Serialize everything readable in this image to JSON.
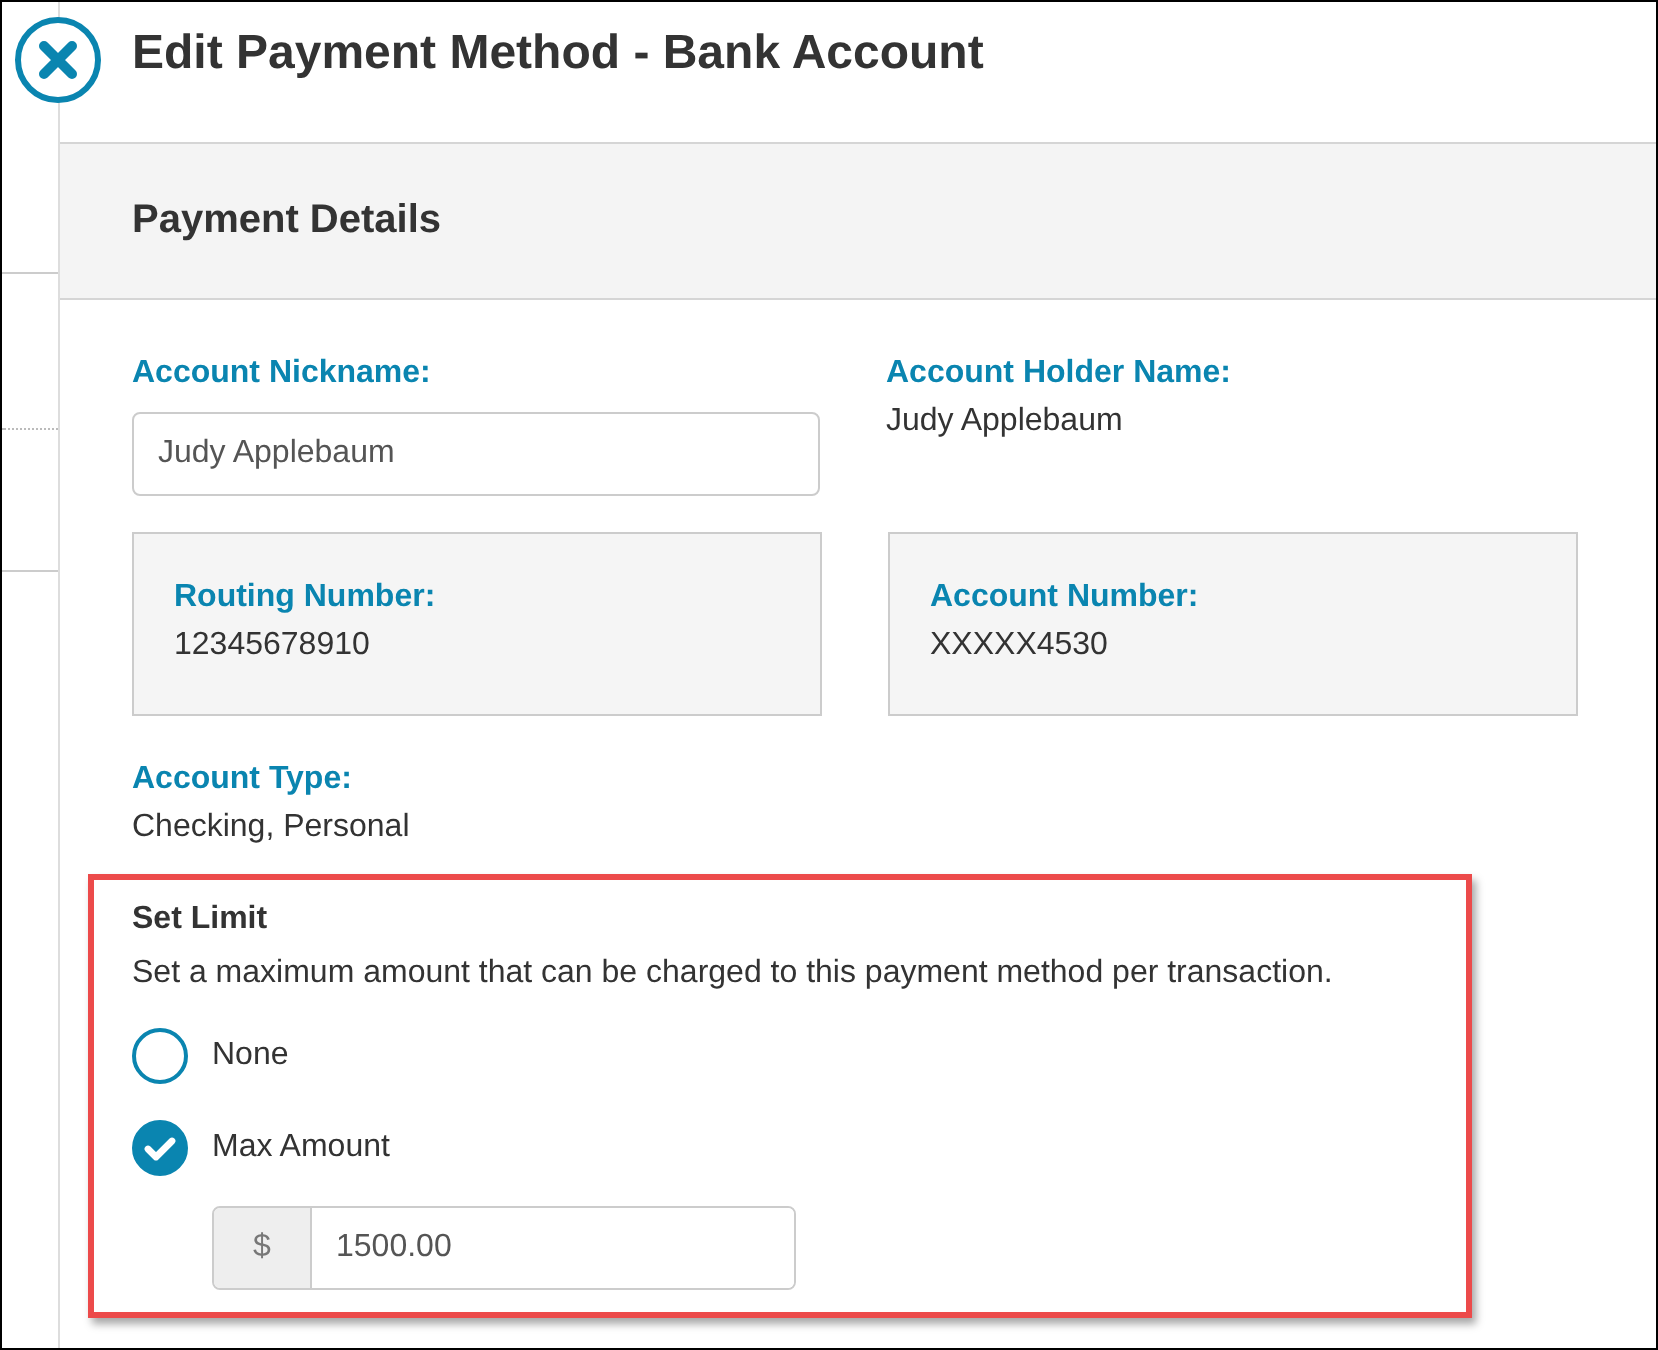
{
  "window": {
    "title": "Edit Payment Method - Bank Account"
  },
  "section": {
    "title": "Payment Details"
  },
  "nickname": {
    "label": "Account Nickname:",
    "value": "Judy Applebaum"
  },
  "holder": {
    "label": "Account Holder Name:",
    "value": "Judy Applebaum"
  },
  "routing": {
    "label": "Routing Number:",
    "value": "12345678910"
  },
  "account_number": {
    "label": "Account Number:",
    "value": "XXXXX4530"
  },
  "account_type": {
    "label": "Account Type:",
    "value": "Checking, Personal"
  },
  "limit": {
    "title": "Set Limit",
    "description": "Set a maximum amount that can be charged to this payment method per transaction.",
    "options": [
      {
        "label": "None",
        "selected": false
      },
      {
        "label": "Max Amount",
        "selected": true
      }
    ],
    "amount": {
      "prefix": "$",
      "value": "1500.00"
    }
  }
}
